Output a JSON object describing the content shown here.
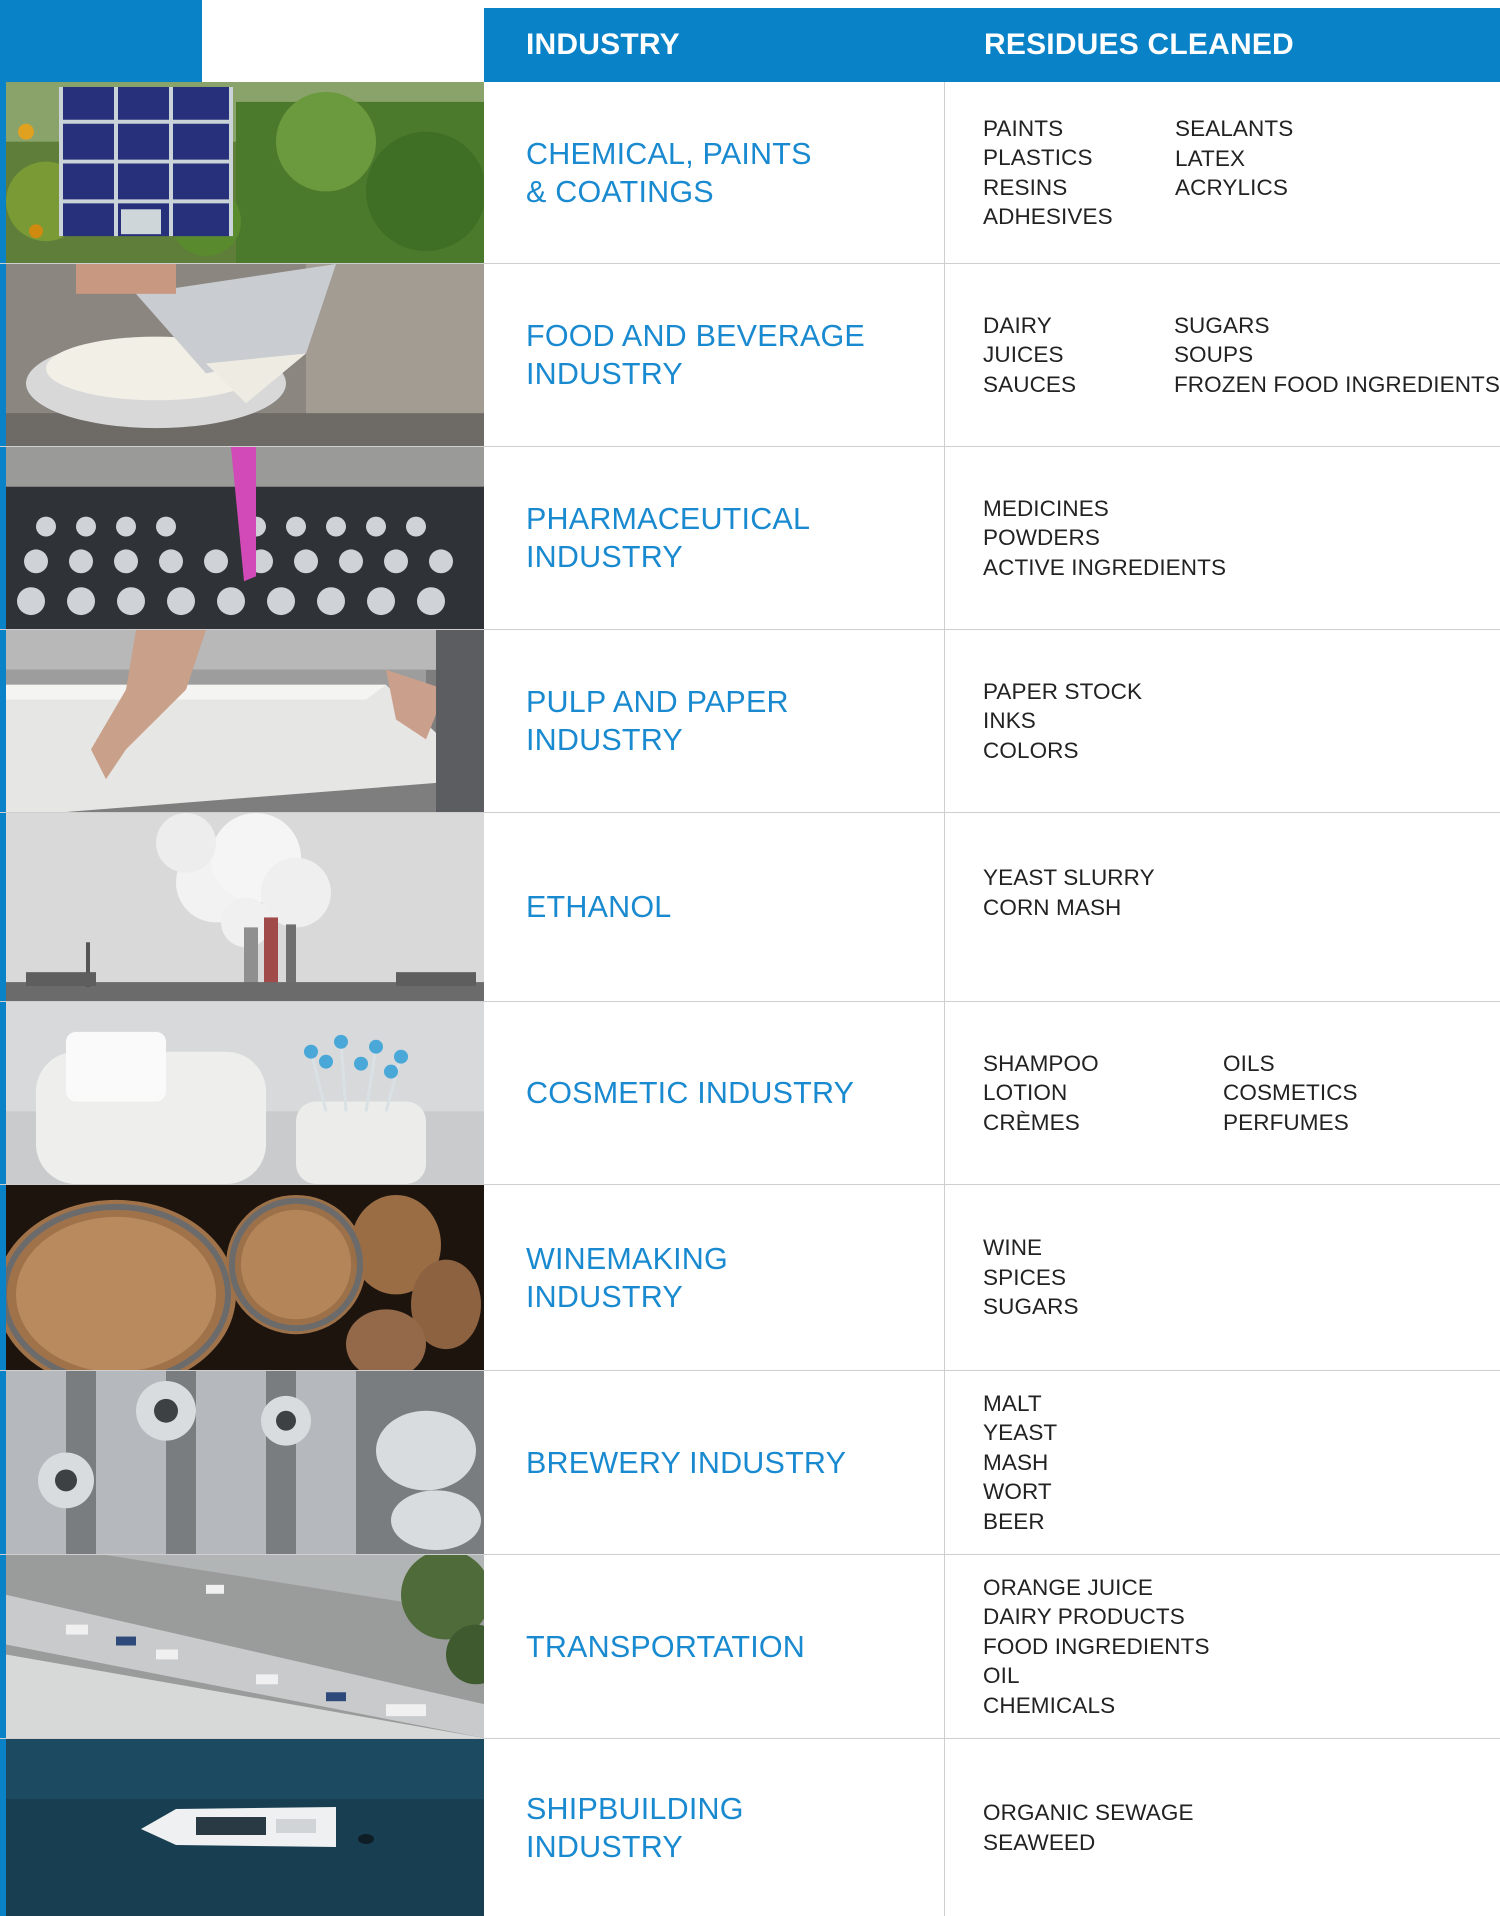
{
  "header": {
    "industry_label": "INDUSTRY",
    "residues_label": "RESIDUES CLEANED"
  },
  "colors": {
    "accent": "#0a82c8",
    "industry_text": "#1a8ad0",
    "residue_text": "#222222",
    "divider": "#cfcfcf"
  },
  "rows": [
    {
      "industry": "CHEMICAL, PAINTS\n& COATINGS",
      "image": "ibc-tank-in-greenery-photo",
      "col1": [
        "PAINTS",
        "PLASTICS",
        "RESINS",
        "ADHESIVES"
      ],
      "col2": [
        "SEALANTS",
        "LATEX",
        "ACRYLICS"
      ]
    },
    {
      "industry": "FOOD AND BEVERAGE\nINDUSTRY",
      "image": "pouring-milk-photo",
      "col1": [
        "DAIRY",
        "JUICES",
        "SAUCES"
      ],
      "col2": [
        "SUGARS",
        "SOUPS",
        "FROZEN FOOD INGREDIENTS"
      ]
    },
    {
      "industry": "PHARMACEUTICAL\nINDUSTRY",
      "image": "lab-vials-pipette-photo",
      "col1": [
        "MEDICINES",
        "POWDERS",
        "ACTIVE INGREDIENTS"
      ],
      "col2": []
    },
    {
      "industry": "PULP AND PAPER\nINDUSTRY",
      "image": "paper-stack-photo",
      "col1": [
        "PAPER STOCK",
        "INKS",
        "COLORS"
      ],
      "col2": []
    },
    {
      "industry": "ETHANOL",
      "image": "smokestacks-photo",
      "col1": [
        "YEAST SLURRY",
        "CORN MASH"
      ],
      "col2": []
    },
    {
      "industry": "COSMETIC INDUSTRY",
      "image": "cotton-swabs-photo",
      "col1": [
        "SHAMPOO",
        "LOTION",
        "CRÈMES"
      ],
      "col2": [
        "OILS",
        "COSMETICS",
        "PERFUMES"
      ]
    },
    {
      "industry": "WINEMAKING\nINDUSTRY",
      "image": "wine-barrels-photo",
      "col1": [
        "WINE",
        "SPICES",
        "SUGARS"
      ],
      "col2": []
    },
    {
      "industry": "BREWERY INDUSTRY",
      "image": "brewery-tanks-photo",
      "col1": [
        "MALT",
        "YEAST",
        "MASH",
        "WORT",
        "BEER"
      ],
      "col2": []
    },
    {
      "industry": "TRANSPORTATION",
      "image": "highway-aerial-photo",
      "col1": [
        "ORANGE JUICE",
        "DAIRY PRODUCTS",
        "FOOD INGREDIENTS",
        "OIL",
        "CHEMICALS"
      ],
      "col2": []
    },
    {
      "industry": "SHIPBUILDING\nINDUSTRY",
      "image": "yacht-on-sea-photo",
      "col1": [
        "ORGANIC SEWAGE",
        "SEAWEED"
      ],
      "col2": []
    }
  ]
}
